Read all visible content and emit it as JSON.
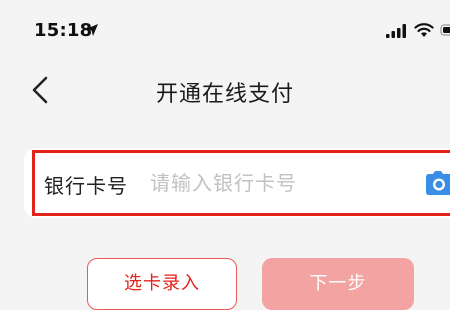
{
  "status_bar": {
    "time": "15:18",
    "icons": [
      "location-arrow-icon",
      "cellular-signal-icon",
      "wifi-icon",
      "battery-icon"
    ]
  },
  "nav": {
    "back_icon": "chevron-left-icon",
    "title": "开通在线支付"
  },
  "card_form": {
    "label": "银行卡号",
    "placeholder": "请输入银行卡号",
    "value": "",
    "camera_icon": "camera-icon",
    "highlight_color": "#e2231a"
  },
  "actions": {
    "select_card_label": "选卡录入",
    "next_step_label": "下一步"
  },
  "colors": {
    "accent": "#e2231a",
    "next_disabled_bg": "#f4a3a3",
    "camera_blue": "#3a8ee6",
    "background": "#f4f4f4"
  }
}
